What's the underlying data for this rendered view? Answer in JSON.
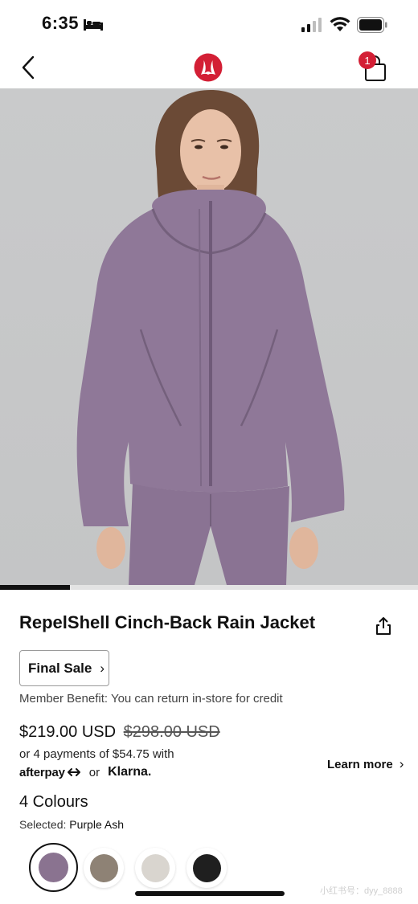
{
  "status": {
    "time": "6:35",
    "icons": [
      "bed-icon",
      "signal-icon",
      "wifi-icon",
      "battery-icon"
    ]
  },
  "nav": {
    "back_icon": "chevron-left-icon",
    "logo": "lululemon-logo",
    "bag_count": "1",
    "bag_icon": "shopping-bag-icon"
  },
  "hero": {
    "progress_fraction": 0.167
  },
  "product": {
    "title": "RepelShell Cinch-Back Rain Jacket",
    "share_icon": "share-icon",
    "final_sale_label": "Final Sale",
    "member_benefit": "Member Benefit: You can return in-store for credit",
    "price_current": "$219.00 USD",
    "price_old": "$298.00 USD",
    "installments": "or 4 payments of $54.75 with",
    "afterpay": "afterpay",
    "or": "or",
    "klarna": "Klarna.",
    "learn_more": "Learn more",
    "colours_heading": "4 Colours",
    "selected_label": "Selected:",
    "selected_value": "Purple Ash",
    "swatches": [
      {
        "name": "Purple Ash",
        "color": "#8a7390",
        "selected": true
      },
      {
        "name": "Taupe",
        "color": "#8e8275",
        "selected": false
      },
      {
        "name": "Bone",
        "color": "#d9d5cf",
        "selected": false
      },
      {
        "name": "Black",
        "color": "#1f1f1f",
        "selected": false
      }
    ]
  },
  "colors": {
    "accent_red": "#d31f35",
    "jacket_purple": "#8f7898"
  },
  "watermark": "小红书号：dyy_8888"
}
